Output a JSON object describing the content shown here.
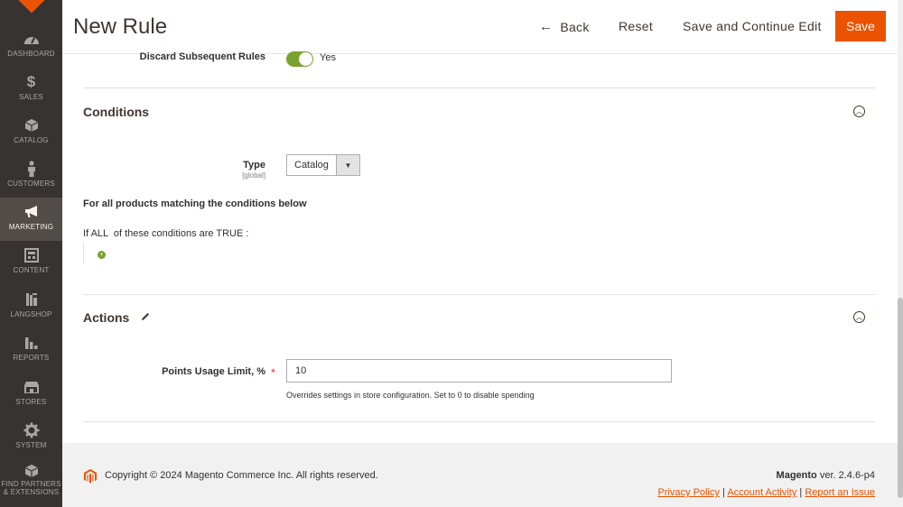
{
  "sidebar": {
    "items": [
      {
        "label": "Dashboard",
        "icon": "dashboard-icon"
      },
      {
        "label": "Sales",
        "icon": "dollar-icon"
      },
      {
        "label": "Catalog",
        "icon": "cube-icon"
      },
      {
        "label": "Customers",
        "icon": "person-icon"
      },
      {
        "label": "Marketing",
        "icon": "megaphone-icon"
      },
      {
        "label": "Content",
        "icon": "layout-icon"
      },
      {
        "label": "Langshop",
        "icon": "langshop-icon"
      },
      {
        "label": "Reports",
        "icon": "bar-chart-icon"
      },
      {
        "label": "Stores",
        "icon": "store-icon"
      },
      {
        "label": "System",
        "icon": "gear-icon"
      },
      {
        "label": "Find Partners & Extensions",
        "icon": "partners-box-icon"
      }
    ],
    "active": "Marketing"
  },
  "header": {
    "title": "New Rule",
    "back_label": "Back",
    "reset_label": "Reset",
    "save_continue_label": "Save and Continue Edit",
    "save_label": "Save"
  },
  "discard_rules": {
    "label": "Discard Subsequent Rules",
    "value": "Yes",
    "enabled": true
  },
  "conditions": {
    "title": "Conditions",
    "type_label": "Type",
    "type_scope": "[global]",
    "type_value": "Catalog",
    "heading": "For all products matching the conditions below",
    "line_prefix": "If ",
    "aggregator": "ALL",
    "line_middle": "  of these conditions are ",
    "value": "TRUE",
    "line_suffix": " :"
  },
  "actions": {
    "title": "Actions",
    "points_label": "Points Usage Limit, %",
    "points_value": "10",
    "points_note": "Overrides settings in store configuration. Set to 0 to disable spending"
  },
  "footer": {
    "copyright": "Copyright © 2024 Magento Commerce Inc. All rights reserved.",
    "brand": "Magento",
    "version": " ver. 2.4.6-p4",
    "links": [
      "Privacy Policy",
      "Account Activity",
      "Report an Issue"
    ]
  },
  "colors": {
    "accent": "#eb5202",
    "sidebar_bg": "#373330",
    "toggle_on": "#79a22e"
  }
}
